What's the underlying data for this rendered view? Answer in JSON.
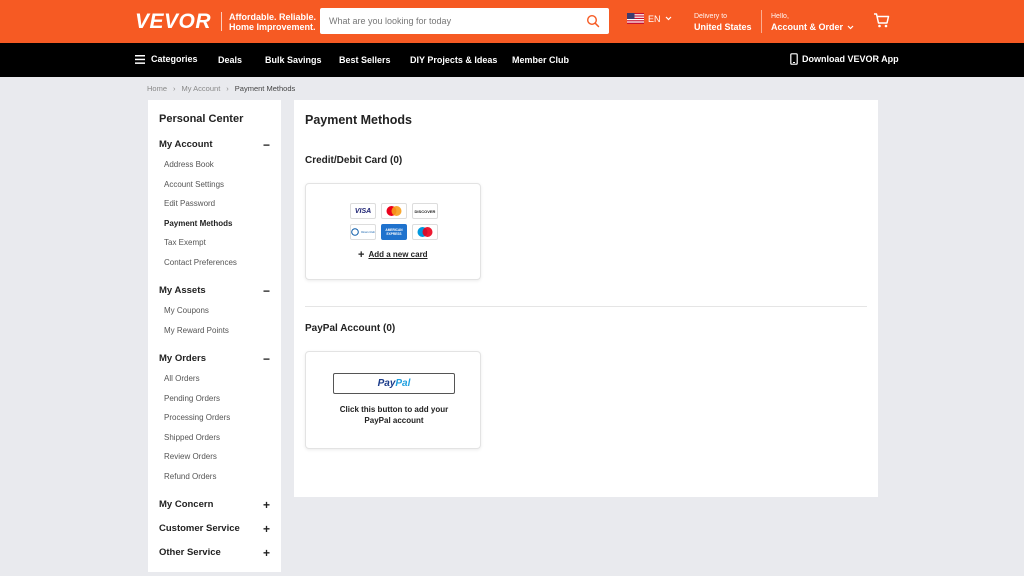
{
  "header": {
    "logo": "VEVOR",
    "tagline_line1": "Affordable. Reliable.",
    "tagline_line2": "Home Improvement.",
    "search_placeholder": "What are you looking for today",
    "language": "EN",
    "delivery_label": "Delivery to",
    "delivery_country": "United States",
    "greeting": "Hello,",
    "account_label": "Account & Order"
  },
  "nav": {
    "categories": "Categories",
    "deals": "Deals",
    "bulk_savings": "Bulk Savings",
    "best_sellers": "Best Sellers",
    "diy": "DIY Projects & Ideas",
    "member_club": "Member Club",
    "download_app": "Download VEVOR App"
  },
  "breadcrumb": {
    "home": "Home",
    "sep": "›",
    "my_account": "My Account",
    "current": "Payment Methods"
  },
  "sidebar": {
    "title": "Personal Center",
    "my_account": {
      "label": "My Account",
      "toggle": "−",
      "items": [
        "Address Book",
        "Account Settings",
        "Edit Password",
        "Payment Methods",
        "Tax Exempt",
        "Contact Preferences"
      ]
    },
    "my_assets": {
      "label": "My Assets",
      "toggle": "−",
      "items": [
        "My Coupons",
        "My Reward Points"
      ]
    },
    "my_orders": {
      "label": "My Orders",
      "toggle": "−",
      "items": [
        "All Orders",
        "Pending Orders",
        "Processing Orders",
        "Shipped Orders",
        "Review Orders",
        "Refund Orders"
      ]
    },
    "my_concern": {
      "label": "My Concern",
      "toggle": "+"
    },
    "customer_service": {
      "label": "Customer Service",
      "toggle": "+"
    },
    "other_service": {
      "label": "Other Service",
      "toggle": "+"
    }
  },
  "main": {
    "title": "Payment Methods",
    "credit_title": "Credit/Debit Card (0)",
    "card_logos": {
      "visa": "VISA",
      "discover": "DISCOVER",
      "diners": "Diners Club",
      "amex": "AMERICAN EXPRESS"
    },
    "add_icon": "+",
    "add_card": "Add a new card",
    "paypal_title": "PayPal Account (0)",
    "paypal_btn_dark": "Pay",
    "paypal_btn_light": "Pal",
    "paypal_desc": "Click this button to add your PayPal account"
  },
  "colors": {
    "brand_orange": "#f65a23",
    "nav_black": "#000000",
    "background": "#e9eaee"
  },
  "icons": [
    "search-icon",
    "us-flag-icon",
    "chevron-down-icon",
    "cart-icon",
    "hamburger-icon",
    "phone-icon",
    "plus-icon",
    "minus-icon"
  ]
}
